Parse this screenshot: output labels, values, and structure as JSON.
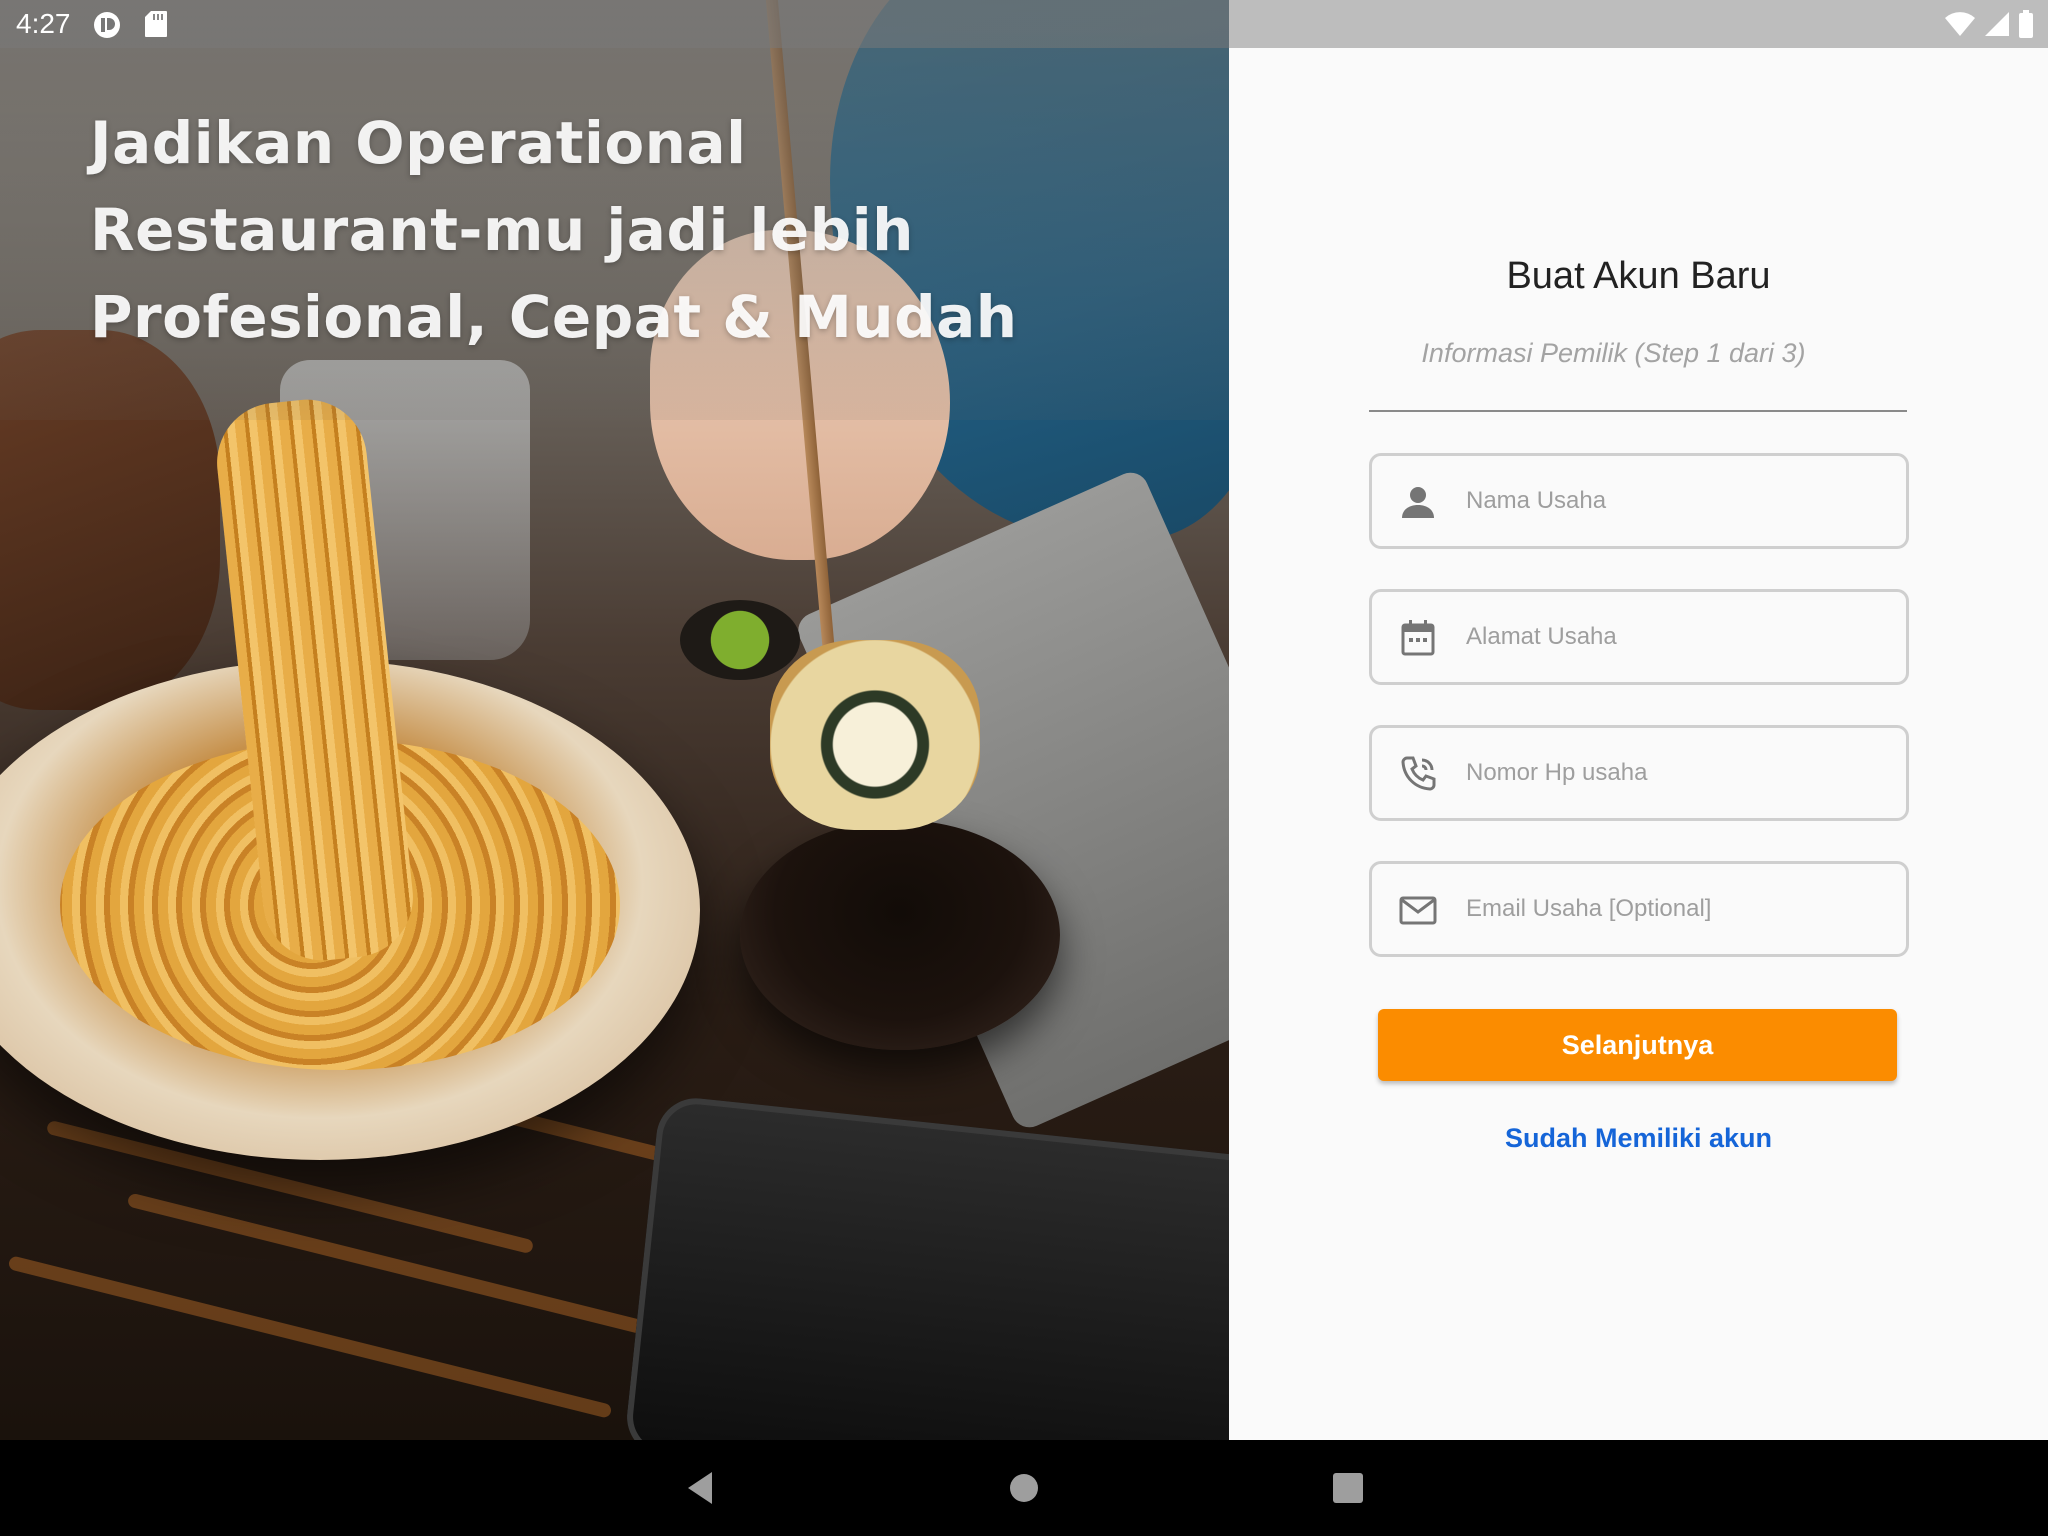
{
  "status_bar": {
    "time": "4:27",
    "left_icons": [
      "app-notification-icon",
      "sd-card-icon"
    ],
    "right_icons": [
      "wifi-icon",
      "cellular-signal-icon",
      "battery-icon"
    ]
  },
  "hero": {
    "headline_lines": [
      "Jadikan Operational",
      "Restaurant-mu jadi lebih",
      "Profesional, Cepat & Mudah"
    ],
    "image_subject": "food-photo"
  },
  "form": {
    "title": "Buat Akun Baru",
    "subtitle": "Informasi Pemilik (Step 1 dari 3)",
    "fields": [
      {
        "icon": "person-icon",
        "placeholder": "Nama Usaha",
        "value": ""
      },
      {
        "icon": "calendar-icon",
        "placeholder": "Alamat Usaha",
        "value": ""
      },
      {
        "icon": "phone-icon",
        "placeholder": "Nomor Hp usaha",
        "value": ""
      },
      {
        "icon": "mail-icon",
        "placeholder": "Email Usaha [Optional]",
        "value": ""
      }
    ],
    "next_button": "Selanjutnya",
    "login_link": "Sudah Memiliki akun"
  },
  "nav_bar": {
    "buttons": [
      "back-icon",
      "home-icon",
      "recents-icon"
    ]
  },
  "colors": {
    "accent": "#fb8c00",
    "link": "#1565d8",
    "field_border": "#cfcfcf",
    "placeholder": "#9e9e9e"
  }
}
